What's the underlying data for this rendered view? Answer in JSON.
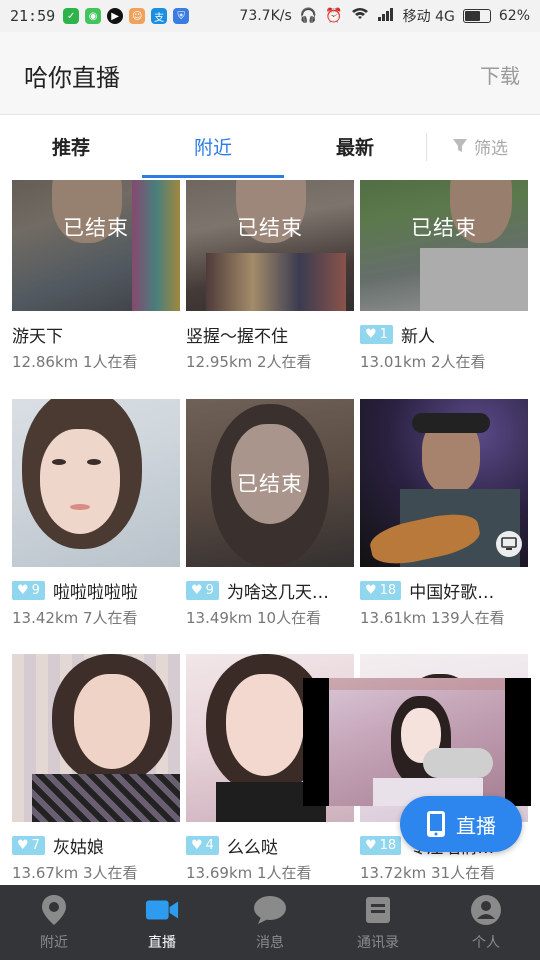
{
  "status_bar": {
    "time": "21:59",
    "speed": "73.7K/s",
    "carrier": "移动 4G",
    "battery": "62%",
    "app_icons": [
      "wechat-icon",
      "wechat-icon",
      "record-icon",
      "chat-icon",
      "alipay-icon",
      "shield-icon"
    ]
  },
  "header": {
    "title": "哈你直播",
    "download_label": "下载"
  },
  "tabs": {
    "items": [
      "推荐",
      "附近",
      "最新"
    ],
    "active": "附近",
    "filter_label": "筛选"
  },
  "colors": {
    "accent": "#2d7be5",
    "badge": "#8fd6ee",
    "nav_bg": "#333538"
  },
  "ended_label": "已结束",
  "cards": [
    {
      "name": "游天下",
      "meta": "12.86km 1人在看",
      "ended": true,
      "badge": null
    },
    {
      "name": "竖握～握不住",
      "meta": "12.95km 2人在看",
      "ended": true,
      "badge": null
    },
    {
      "name": "新人",
      "meta": "13.01km 2人在看",
      "ended": true,
      "badge": "1"
    },
    {
      "name": "啦啦啦啦啦",
      "meta": "13.42km 7人在看",
      "ended": false,
      "badge": "9"
    },
    {
      "name": "为啥这几天…",
      "meta": "13.49km 10人在看",
      "ended": true,
      "badge": "9"
    },
    {
      "name": "中国好歌…",
      "meta": "13.61km 139人在看",
      "ended": false,
      "badge": "18",
      "screen_icon": "monitor-icon"
    },
    {
      "name": "灰姑娘",
      "meta": "13.67km 3人在看",
      "ended": false,
      "badge": "7"
    },
    {
      "name": "么么哒",
      "meta": "13.69km 1人在看",
      "ended": false,
      "badge": "4"
    },
    {
      "name": "专注唱情…",
      "meta": "13.72km 31人在看",
      "ended": false,
      "badge": "18"
    }
  ],
  "floating": {
    "live_label": "直播"
  },
  "bottom_nav": [
    {
      "label": "附近",
      "icon": "location-pin-icon"
    },
    {
      "label": "直播",
      "icon": "video-camera-icon",
      "active": true
    },
    {
      "label": "消息",
      "icon": "chat-bubble-icon"
    },
    {
      "label": "通讯录",
      "icon": "contacts-icon"
    },
    {
      "label": "个人",
      "icon": "person-icon"
    }
  ]
}
